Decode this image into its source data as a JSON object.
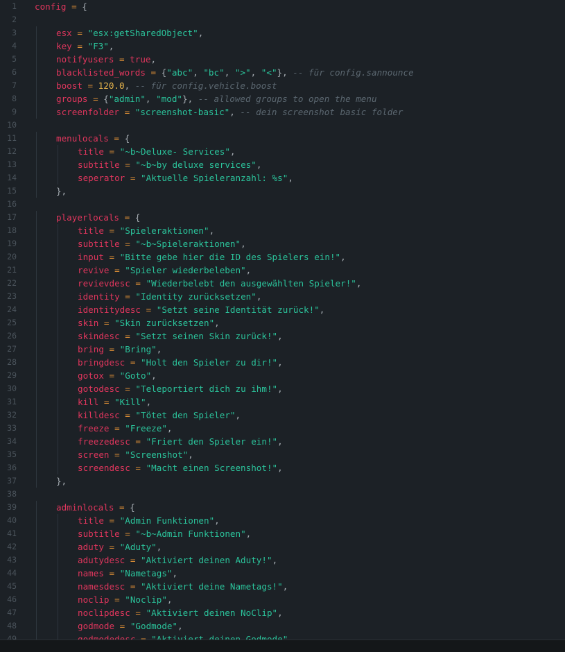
{
  "lines": [
    {
      "n": "1",
      "indent": 0,
      "t": [
        {
          "c": "key",
          "v": "config"
        },
        {
          "c": "op",
          "v": " = "
        },
        {
          "c": "punc",
          "v": "{"
        }
      ]
    },
    {
      "n": "2",
      "indent": 0,
      "t": []
    },
    {
      "n": "3",
      "indent": 1,
      "t": [
        {
          "c": "key",
          "v": "esx"
        },
        {
          "c": "op",
          "v": " = "
        },
        {
          "c": "str",
          "v": "\"esx:getSharedObject\""
        },
        {
          "c": "punc",
          "v": ","
        }
      ]
    },
    {
      "n": "4",
      "indent": 1,
      "t": [
        {
          "c": "key",
          "v": "key"
        },
        {
          "c": "op",
          "v": " = "
        },
        {
          "c": "str",
          "v": "\"F3\""
        },
        {
          "c": "punc",
          "v": ","
        }
      ]
    },
    {
      "n": "5",
      "indent": 1,
      "t": [
        {
          "c": "key",
          "v": "notifyusers"
        },
        {
          "c": "op",
          "v": " = "
        },
        {
          "c": "bool",
          "v": "true"
        },
        {
          "c": "punc",
          "v": ","
        }
      ]
    },
    {
      "n": "6",
      "indent": 1,
      "t": [
        {
          "c": "key",
          "v": "blacklisted_words"
        },
        {
          "c": "op",
          "v": " = "
        },
        {
          "c": "punc",
          "v": "{"
        },
        {
          "c": "str",
          "v": "\"abc\""
        },
        {
          "c": "punc",
          "v": ", "
        },
        {
          "c": "str",
          "v": "\"bc\""
        },
        {
          "c": "punc",
          "v": ", "
        },
        {
          "c": "str",
          "v": "\">\""
        },
        {
          "c": "punc",
          "v": ", "
        },
        {
          "c": "str",
          "v": "\"<\""
        },
        {
          "c": "punc",
          "v": "}, "
        },
        {
          "c": "cm",
          "v": "-- für config.sannounce"
        }
      ]
    },
    {
      "n": "7",
      "indent": 1,
      "t": [
        {
          "c": "key",
          "v": "boost"
        },
        {
          "c": "op",
          "v": " = "
        },
        {
          "c": "num",
          "v": "120.0"
        },
        {
          "c": "punc",
          "v": ", "
        },
        {
          "c": "cm",
          "v": "-- für config.vehicle.boost"
        }
      ]
    },
    {
      "n": "8",
      "indent": 1,
      "t": [
        {
          "c": "key",
          "v": "groups"
        },
        {
          "c": "op",
          "v": " = "
        },
        {
          "c": "punc",
          "v": "{"
        },
        {
          "c": "str",
          "v": "\"admin\""
        },
        {
          "c": "punc",
          "v": ", "
        },
        {
          "c": "str",
          "v": "\"mod\""
        },
        {
          "c": "punc",
          "v": "}, "
        },
        {
          "c": "cm",
          "v": "-- allowed groups to open the menu"
        }
      ]
    },
    {
      "n": "9",
      "indent": 1,
      "t": [
        {
          "c": "key",
          "v": "screenfolder"
        },
        {
          "c": "op",
          "v": " = "
        },
        {
          "c": "str",
          "v": "\"screenshot-basic\""
        },
        {
          "c": "punc",
          "v": ", "
        },
        {
          "c": "cm",
          "v": "-- dein screenshot basic folder"
        }
      ]
    },
    {
      "n": "10",
      "indent": 0,
      "t": []
    },
    {
      "n": "11",
      "indent": 1,
      "t": [
        {
          "c": "key",
          "v": "menulocals"
        },
        {
          "c": "op",
          "v": " = "
        },
        {
          "c": "punc",
          "v": "{"
        }
      ]
    },
    {
      "n": "12",
      "indent": 2,
      "t": [
        {
          "c": "key",
          "v": "title"
        },
        {
          "c": "op",
          "v": " = "
        },
        {
          "c": "str",
          "v": "\"~b~Deluxe- Services\""
        },
        {
          "c": "punc",
          "v": ","
        }
      ]
    },
    {
      "n": "13",
      "indent": 2,
      "t": [
        {
          "c": "key",
          "v": "subtitle"
        },
        {
          "c": "op",
          "v": " = "
        },
        {
          "c": "str",
          "v": "\"~b~by deluxe services\""
        },
        {
          "c": "punc",
          "v": ","
        }
      ]
    },
    {
      "n": "14",
      "indent": 2,
      "t": [
        {
          "c": "key",
          "v": "seperator"
        },
        {
          "c": "op",
          "v": " = "
        },
        {
          "c": "str",
          "v": "\"Aktuelle Spieleranzahl: %s\""
        },
        {
          "c": "punc",
          "v": ","
        }
      ]
    },
    {
      "n": "15",
      "indent": 1,
      "t": [
        {
          "c": "punc",
          "v": "},"
        }
      ]
    },
    {
      "n": "16",
      "indent": 0,
      "t": []
    },
    {
      "n": "17",
      "indent": 1,
      "t": [
        {
          "c": "key",
          "v": "playerlocals"
        },
        {
          "c": "op",
          "v": " = "
        },
        {
          "c": "punc",
          "v": "{"
        }
      ]
    },
    {
      "n": "18",
      "indent": 2,
      "t": [
        {
          "c": "key",
          "v": "title"
        },
        {
          "c": "op",
          "v": " = "
        },
        {
          "c": "str",
          "v": "\"Spieleraktionen\""
        },
        {
          "c": "punc",
          "v": ","
        }
      ]
    },
    {
      "n": "19",
      "indent": 2,
      "t": [
        {
          "c": "key",
          "v": "subtitle"
        },
        {
          "c": "op",
          "v": " = "
        },
        {
          "c": "str",
          "v": "\"~b~Spieleraktionen\""
        },
        {
          "c": "punc",
          "v": ","
        }
      ]
    },
    {
      "n": "20",
      "indent": 2,
      "t": [
        {
          "c": "key",
          "v": "input"
        },
        {
          "c": "op",
          "v": " = "
        },
        {
          "c": "str",
          "v": "\"Bitte gebe hier die ID des Spielers ein!\""
        },
        {
          "c": "punc",
          "v": ","
        }
      ]
    },
    {
      "n": "21",
      "indent": 2,
      "t": [
        {
          "c": "key",
          "v": "revive"
        },
        {
          "c": "op",
          "v": " = "
        },
        {
          "c": "str",
          "v": "\"Spieler wiederbeleben\""
        },
        {
          "c": "punc",
          "v": ","
        }
      ]
    },
    {
      "n": "22",
      "indent": 2,
      "t": [
        {
          "c": "key",
          "v": "revievdesc"
        },
        {
          "c": "op",
          "v": " = "
        },
        {
          "c": "str",
          "v": "\"Wiederbelebt den ausgewählten Spieler!\""
        },
        {
          "c": "punc",
          "v": ","
        }
      ]
    },
    {
      "n": "23",
      "indent": 2,
      "t": [
        {
          "c": "key",
          "v": "identity"
        },
        {
          "c": "op",
          "v": " = "
        },
        {
          "c": "str",
          "v": "\"Identity zurücksetzen\""
        },
        {
          "c": "punc",
          "v": ","
        }
      ]
    },
    {
      "n": "24",
      "indent": 2,
      "t": [
        {
          "c": "key",
          "v": "identitydesc"
        },
        {
          "c": "op",
          "v": " = "
        },
        {
          "c": "str",
          "v": "\"Setzt seine Identität zurück!\""
        },
        {
          "c": "punc",
          "v": ","
        }
      ]
    },
    {
      "n": "25",
      "indent": 2,
      "t": [
        {
          "c": "key",
          "v": "skin"
        },
        {
          "c": "op",
          "v": " = "
        },
        {
          "c": "str",
          "v": "\"Skin zurücksetzen\""
        },
        {
          "c": "punc",
          "v": ","
        }
      ]
    },
    {
      "n": "26",
      "indent": 2,
      "t": [
        {
          "c": "key",
          "v": "skindesc"
        },
        {
          "c": "op",
          "v": " = "
        },
        {
          "c": "str",
          "v": "\"Setzt seinen Skin zurück!\""
        },
        {
          "c": "punc",
          "v": ","
        }
      ]
    },
    {
      "n": "27",
      "indent": 2,
      "t": [
        {
          "c": "key",
          "v": "bring"
        },
        {
          "c": "op",
          "v": " = "
        },
        {
          "c": "str",
          "v": "\"Bring\""
        },
        {
          "c": "punc",
          "v": ","
        }
      ]
    },
    {
      "n": "28",
      "indent": 2,
      "t": [
        {
          "c": "key",
          "v": "bringdesc"
        },
        {
          "c": "op",
          "v": " = "
        },
        {
          "c": "str",
          "v": "\"Holt den Spieler zu dir!\""
        },
        {
          "c": "punc",
          "v": ","
        }
      ]
    },
    {
      "n": "29",
      "indent": 2,
      "t": [
        {
          "c": "key",
          "v": "gotox"
        },
        {
          "c": "op",
          "v": " = "
        },
        {
          "c": "str",
          "v": "\"Goto\""
        },
        {
          "c": "punc",
          "v": ","
        }
      ]
    },
    {
      "n": "30",
      "indent": 2,
      "t": [
        {
          "c": "key",
          "v": "gotodesc"
        },
        {
          "c": "op",
          "v": " = "
        },
        {
          "c": "str",
          "v": "\"Teleportiert dich zu ihm!\""
        },
        {
          "c": "punc",
          "v": ","
        }
      ]
    },
    {
      "n": "31",
      "indent": 2,
      "t": [
        {
          "c": "key",
          "v": "kill"
        },
        {
          "c": "op",
          "v": " = "
        },
        {
          "c": "str",
          "v": "\"Kill\""
        },
        {
          "c": "punc",
          "v": ","
        }
      ]
    },
    {
      "n": "32",
      "indent": 2,
      "t": [
        {
          "c": "key",
          "v": "killdesc"
        },
        {
          "c": "op",
          "v": " = "
        },
        {
          "c": "str",
          "v": "\"Tötet den Spieler\""
        },
        {
          "c": "punc",
          "v": ","
        }
      ]
    },
    {
      "n": "33",
      "indent": 2,
      "t": [
        {
          "c": "key",
          "v": "freeze"
        },
        {
          "c": "op",
          "v": " = "
        },
        {
          "c": "str",
          "v": "\"Freeze\""
        },
        {
          "c": "punc",
          "v": ","
        }
      ]
    },
    {
      "n": "34",
      "indent": 2,
      "t": [
        {
          "c": "key",
          "v": "freezedesc"
        },
        {
          "c": "op",
          "v": " = "
        },
        {
          "c": "str",
          "v": "\"Friert den Spieler ein!\""
        },
        {
          "c": "punc",
          "v": ","
        }
      ]
    },
    {
      "n": "35",
      "indent": 2,
      "t": [
        {
          "c": "key",
          "v": "screen"
        },
        {
          "c": "op",
          "v": " = "
        },
        {
          "c": "str",
          "v": "\"Screenshot\""
        },
        {
          "c": "punc",
          "v": ","
        }
      ]
    },
    {
      "n": "36",
      "indent": 2,
      "t": [
        {
          "c": "key",
          "v": "screendesc"
        },
        {
          "c": "op",
          "v": " = "
        },
        {
          "c": "str",
          "v": "\"Macht einen Screenshot!\""
        },
        {
          "c": "punc",
          "v": ","
        }
      ]
    },
    {
      "n": "37",
      "indent": 1,
      "t": [
        {
          "c": "punc",
          "v": "},"
        }
      ]
    },
    {
      "n": "38",
      "indent": 0,
      "t": []
    },
    {
      "n": "39",
      "indent": 1,
      "t": [
        {
          "c": "key",
          "v": "adminlocals"
        },
        {
          "c": "op",
          "v": " = "
        },
        {
          "c": "punc",
          "v": "{"
        }
      ]
    },
    {
      "n": "40",
      "indent": 2,
      "t": [
        {
          "c": "key",
          "v": "title"
        },
        {
          "c": "op",
          "v": " = "
        },
        {
          "c": "str",
          "v": "\"Admin Funktionen\""
        },
        {
          "c": "punc",
          "v": ","
        }
      ]
    },
    {
      "n": "41",
      "indent": 2,
      "t": [
        {
          "c": "key",
          "v": "subtitle"
        },
        {
          "c": "op",
          "v": " = "
        },
        {
          "c": "str",
          "v": "\"~b~Admin Funktionen\""
        },
        {
          "c": "punc",
          "v": ","
        }
      ]
    },
    {
      "n": "42",
      "indent": 2,
      "t": [
        {
          "c": "key",
          "v": "aduty"
        },
        {
          "c": "op",
          "v": " = "
        },
        {
          "c": "str",
          "v": "\"Aduty\""
        },
        {
          "c": "punc",
          "v": ","
        }
      ]
    },
    {
      "n": "43",
      "indent": 2,
      "t": [
        {
          "c": "key",
          "v": "adutydesc"
        },
        {
          "c": "op",
          "v": " = "
        },
        {
          "c": "str",
          "v": "\"Aktiviert deinen Aduty!\""
        },
        {
          "c": "punc",
          "v": ","
        }
      ]
    },
    {
      "n": "44",
      "indent": 2,
      "t": [
        {
          "c": "key",
          "v": "names"
        },
        {
          "c": "op",
          "v": " = "
        },
        {
          "c": "str",
          "v": "\"Nametags\""
        },
        {
          "c": "punc",
          "v": ","
        }
      ]
    },
    {
      "n": "45",
      "indent": 2,
      "t": [
        {
          "c": "key",
          "v": "namesdesc"
        },
        {
          "c": "op",
          "v": " = "
        },
        {
          "c": "str",
          "v": "\"Aktiviert deine Nametags!\""
        },
        {
          "c": "punc",
          "v": ","
        }
      ]
    },
    {
      "n": "46",
      "indent": 2,
      "t": [
        {
          "c": "key",
          "v": "noclip"
        },
        {
          "c": "op",
          "v": " = "
        },
        {
          "c": "str",
          "v": "\"Noclip\""
        },
        {
          "c": "punc",
          "v": ","
        }
      ]
    },
    {
      "n": "47",
      "indent": 2,
      "t": [
        {
          "c": "key",
          "v": "noclipdesc"
        },
        {
          "c": "op",
          "v": " = "
        },
        {
          "c": "str",
          "v": "\"Aktiviert deinen NoClip\""
        },
        {
          "c": "punc",
          "v": ","
        }
      ]
    },
    {
      "n": "48",
      "indent": 2,
      "t": [
        {
          "c": "key",
          "v": "godmode"
        },
        {
          "c": "op",
          "v": " = "
        },
        {
          "c": "str",
          "v": "\"Godmode\""
        },
        {
          "c": "punc",
          "v": ","
        }
      ]
    },
    {
      "n": "49",
      "indent": 2,
      "t": [
        {
          "c": "key",
          "v": "godmodedesc"
        },
        {
          "c": "op",
          "v": " = "
        },
        {
          "c": "str",
          "v": "\"Aktiviert deinen Godmode\""
        },
        {
          "c": "punc",
          "v": ","
        }
      ]
    }
  ]
}
